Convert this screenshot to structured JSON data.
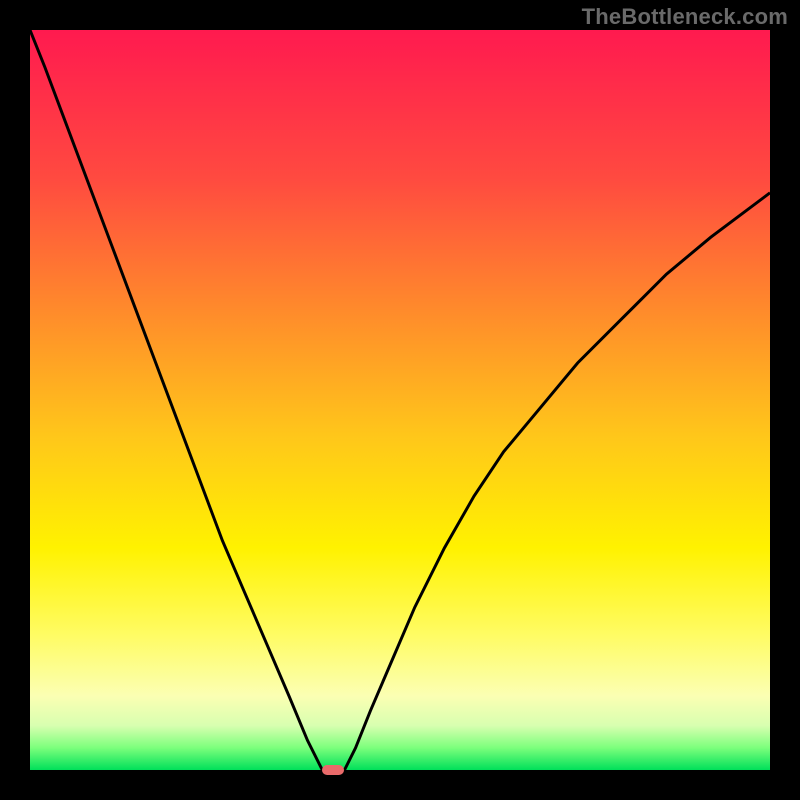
{
  "attribution": "TheBottleneck.com",
  "chart_data": {
    "type": "line",
    "title": "",
    "xlabel": "",
    "ylabel": "",
    "xlim": [
      0,
      100
    ],
    "ylim": [
      0,
      100
    ],
    "series": [
      {
        "name": "left-curve",
        "x": [
          0,
          2,
          5,
          8,
          11,
          14,
          17,
          20,
          23,
          26,
          29,
          32,
          35,
          37.5,
          39.5
        ],
        "y": [
          100,
          95,
          87,
          79,
          71,
          63,
          55,
          47,
          39,
          31,
          24,
          17,
          10,
          4,
          0
        ]
      },
      {
        "name": "right-curve",
        "x": [
          42.5,
          44,
          46,
          49,
          52,
          56,
          60,
          64,
          69,
          74,
          80,
          86,
          92,
          100
        ],
        "y": [
          0,
          3,
          8,
          15,
          22,
          30,
          37,
          43,
          49,
          55,
          61,
          67,
          72,
          78
        ]
      }
    ],
    "marker": {
      "name": "minimum-marker",
      "x": 41,
      "y": 0,
      "color": "#e96a6a",
      "width_pct": 3.0,
      "height_pct": 1.3
    },
    "gradient_stops": [
      {
        "pct": 0,
        "color": "#ff1a4f"
      },
      {
        "pct": 20,
        "color": "#ff4a40"
      },
      {
        "pct": 38,
        "color": "#ff8b2b"
      },
      {
        "pct": 55,
        "color": "#ffc71a"
      },
      {
        "pct": 70,
        "color": "#fff200"
      },
      {
        "pct": 82,
        "color": "#fffc66"
      },
      {
        "pct": 90,
        "color": "#fbffb3"
      },
      {
        "pct": 94,
        "color": "#d8ffb0"
      },
      {
        "pct": 97,
        "color": "#7cff7c"
      },
      {
        "pct": 100,
        "color": "#00e05a"
      }
    ]
  }
}
